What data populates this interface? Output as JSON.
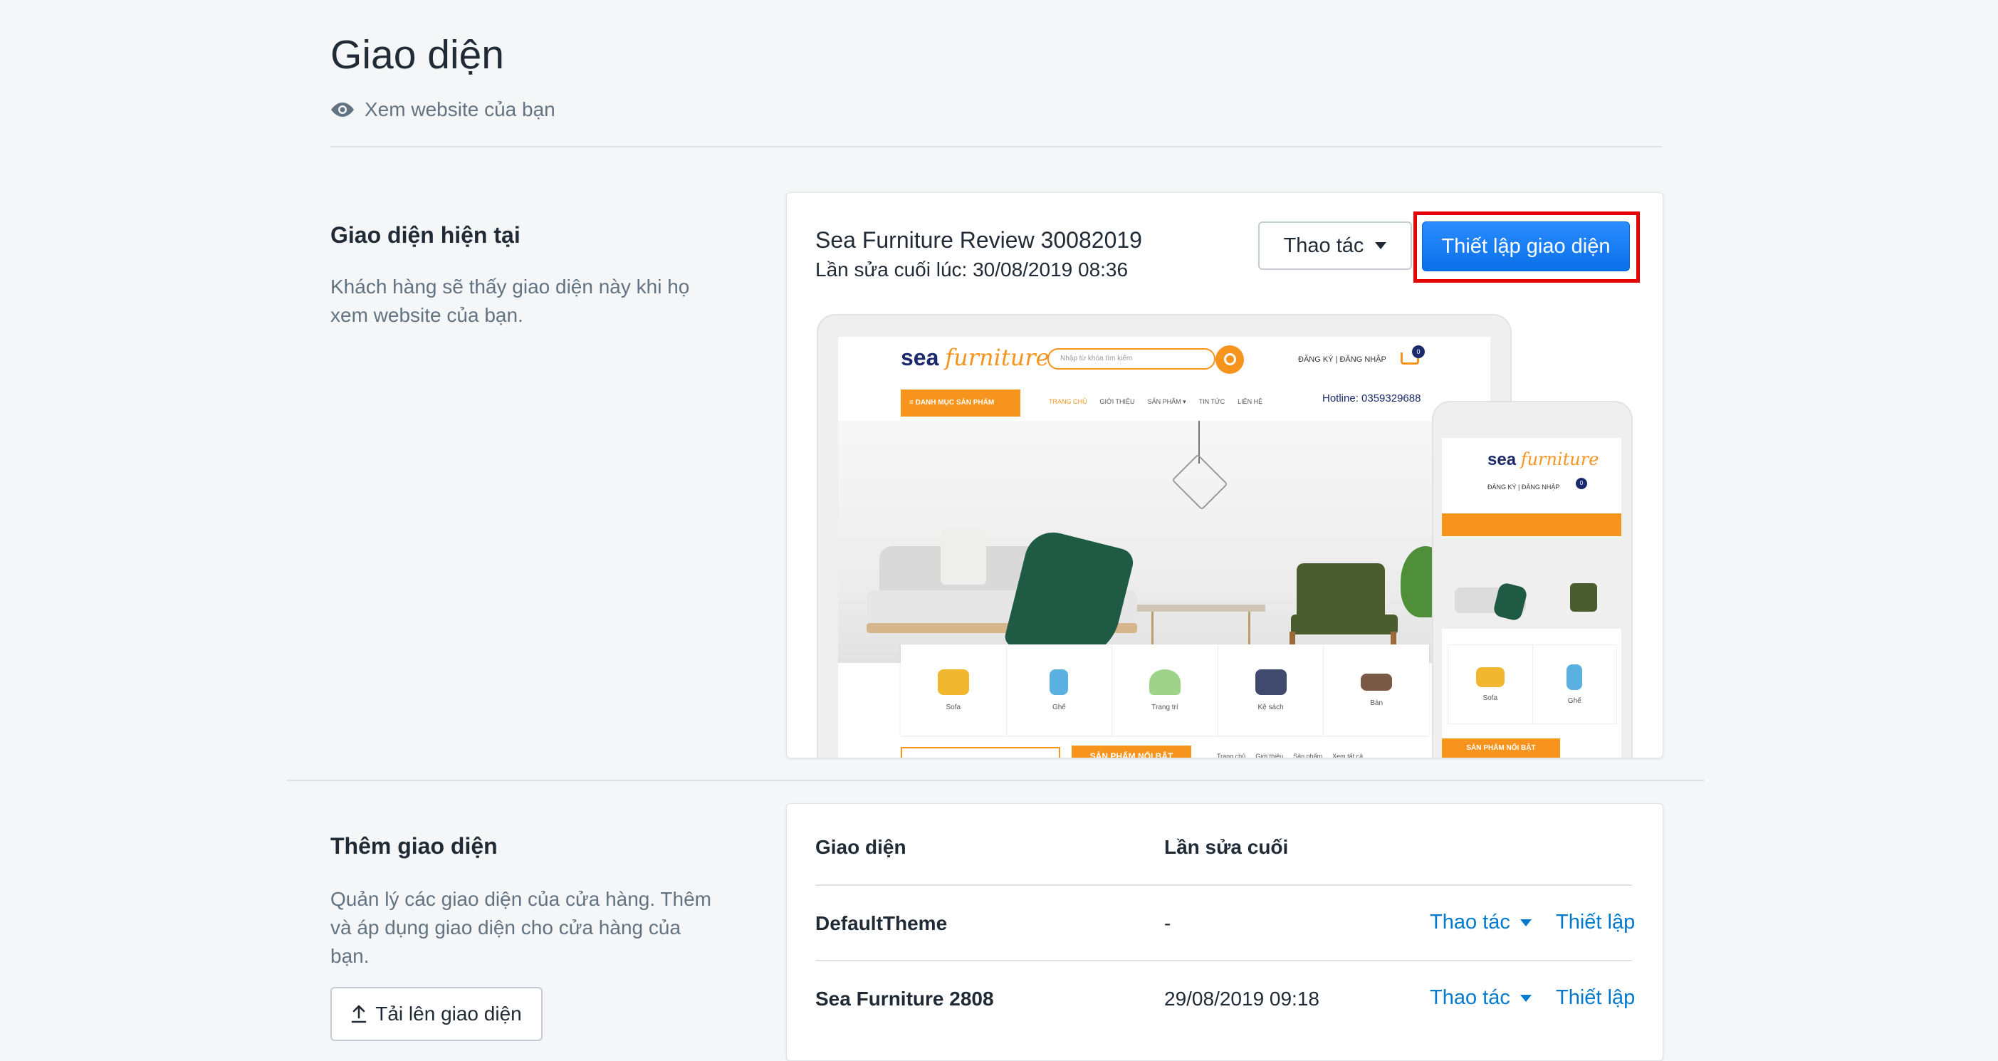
{
  "page": {
    "title": "Giao diện",
    "view_site": "Xem website của bạn"
  },
  "current_theme": {
    "section_title": "Giao diện hiện tại",
    "section_desc": "Khách hàng sẽ thấy giao diện này khi họ xem website của bạn.",
    "theme_name": "Sea Furniture Review 30082019",
    "last_edited": "Lần sửa cuối lúc: 30/08/2019 08:36",
    "actions_label": "Thao tác",
    "customize_label": "Thiết lập giao diện"
  },
  "preview": {
    "logo_main": "sea",
    "logo_script": "furniture",
    "search_placeholder": "Nhập từ khóa tìm kiếm",
    "auth": "ĐĂNG KÝ  |  ĐĂNG NHẬP",
    "cart_count": "0",
    "category_button": "≡  DANH MỤC SẢN PHẨM",
    "nav": [
      "TRANG CHỦ",
      "GIỚI THIỆU",
      "SẢN PHẨM ▾",
      "TIN TỨC",
      "LIÊN HỆ"
    ],
    "hotline": "Hotline: 0359329688",
    "categories": [
      "Sofa",
      "Ghế",
      "Trang trí",
      "Kệ sách",
      "Bàn"
    ],
    "featured": "SẢN PHẨM NỔI BẬT",
    "tabs": [
      "Trang chủ",
      "Giới thiệu",
      "Sản phẩm",
      "Xem tất cả"
    ],
    "mobile_categories": [
      "Sofa",
      "Ghế"
    ],
    "mobile_featured": "SẢN PHẨM NỔI BẬT"
  },
  "add_theme": {
    "section_title": "Thêm giao diện",
    "section_desc": "Quản lý các giao diện của cửa hàng. Thêm và áp dụng giao diện cho cửa hàng của bạn.",
    "upload_label": "Tải lên giao diện",
    "table": {
      "headers": [
        "Giao diện",
        "Lần sửa cuối"
      ],
      "rows": [
        {
          "name": "DefaultTheme",
          "edited": "-",
          "actions": "Thao tác",
          "customize": "Thiết lập"
        },
        {
          "name": "Sea Furniture 2808",
          "edited": "29/08/2019 09:18",
          "actions": "Thao tác",
          "customize": "Thiết lập"
        }
      ]
    }
  },
  "colors": {
    "primary": "#0a6fe8",
    "link": "#007ace",
    "highlight": "#e60000",
    "brand_orange": "#f7941d"
  }
}
